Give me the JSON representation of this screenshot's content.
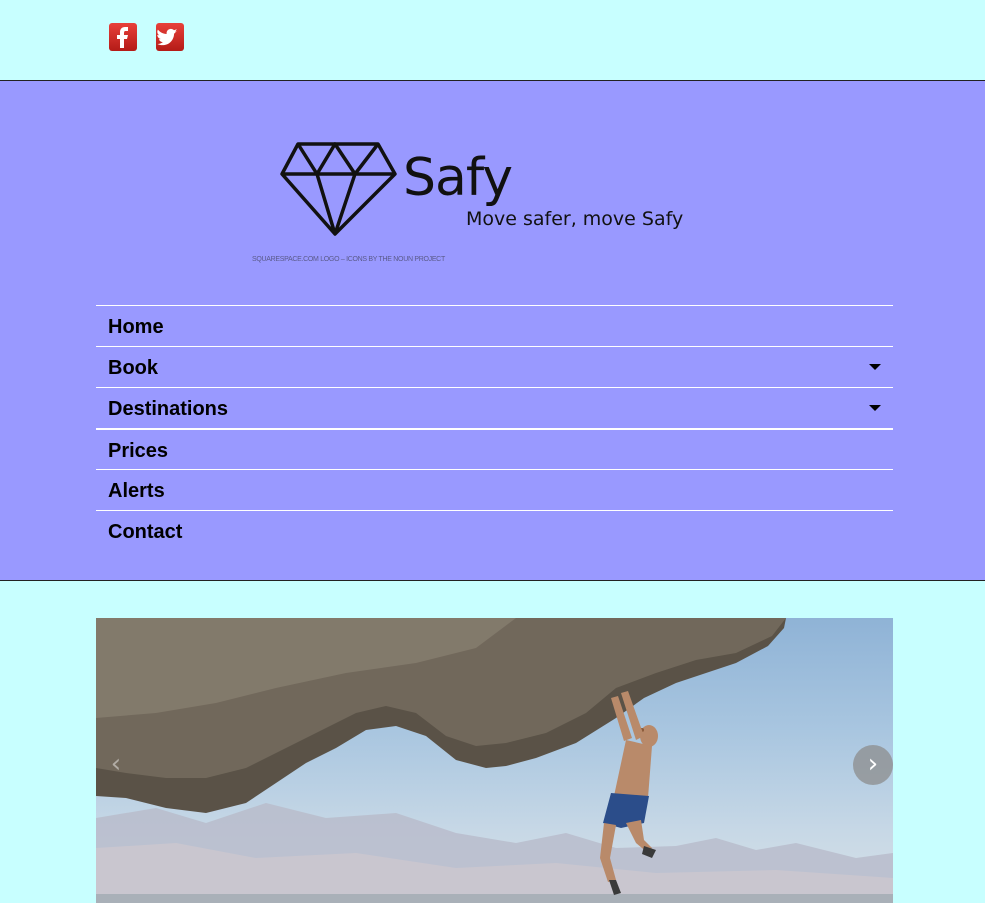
{
  "social": {
    "facebook_icon": "facebook-icon",
    "twitter_icon": "twitter-icon"
  },
  "brand": {
    "name": "Safy",
    "tagline": "Move safer, move Safy",
    "credit": "SQUARESPACE.COM LOGO – ICONS BY THE NOUN PROJECT"
  },
  "nav": {
    "items": [
      {
        "label": "Home"
      },
      {
        "label": "Book"
      },
      {
        "label": "Destinations"
      },
      {
        "label": "Prices"
      },
      {
        "label": "Alerts"
      },
      {
        "label": "Contact"
      }
    ]
  },
  "slider": {
    "prev": "‹",
    "next": "›"
  },
  "colors": {
    "page_bg": "#c8ffff",
    "header_bg": "#9999ff",
    "social_red": "#d0302a"
  }
}
